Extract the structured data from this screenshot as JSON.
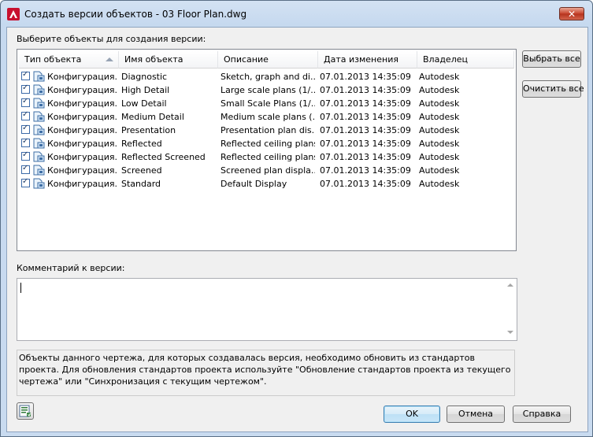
{
  "window": {
    "title": "Создать версии объектов - 03 Floor Plan.dwg",
    "close_label": "x",
    "close_icon": "close-icon"
  },
  "list": {
    "label": "Выберите объекты для создания версии:",
    "columns": [
      "Тип объекта",
      "Имя объекта",
      "Описание",
      "Дата изменения",
      "Владелец"
    ],
    "sort_column": "Тип объекта",
    "rows": [
      {
        "checked": true,
        "type": "Конфигурация...",
        "name": "Diagnostic",
        "description": "Sketch, graph and di...",
        "date": "07.01.2013 14:35:09",
        "owner": "Autodesk"
      },
      {
        "checked": true,
        "type": "Конфигурация...",
        "name": "High Detail",
        "description": "Large scale plans (1/...",
        "date": "07.01.2013 14:35:09",
        "owner": "Autodesk"
      },
      {
        "checked": true,
        "type": "Конфигурация...",
        "name": "Low Detail",
        "description": "Small Scale Plans (1/...",
        "date": "07.01.2013 14:35:09",
        "owner": "Autodesk"
      },
      {
        "checked": true,
        "type": "Конфигурация...",
        "name": "Medium Detail",
        "description": "Medium scale plans (...",
        "date": "07.01.2013 14:35:09",
        "owner": "Autodesk"
      },
      {
        "checked": true,
        "type": "Конфигурация...",
        "name": "Presentation",
        "description": "Presentation plan dis...",
        "date": "07.01.2013 14:35:09",
        "owner": "Autodesk"
      },
      {
        "checked": true,
        "type": "Конфигурация...",
        "name": "Reflected",
        "description": "Reflected ceiling plans",
        "date": "07.01.2013 14:35:09",
        "owner": "Autodesk"
      },
      {
        "checked": true,
        "type": "Конфигурация...",
        "name": "Reflected Screened",
        "description": "Reflected ceiling plans",
        "date": "07.01.2013 14:35:09",
        "owner": "Autodesk"
      },
      {
        "checked": true,
        "type": "Конфигурация...",
        "name": "Screened",
        "description": "Screened plan displa...",
        "date": "07.01.2013 14:35:09",
        "owner": "Autodesk"
      },
      {
        "checked": true,
        "type": "Конфигурация...",
        "name": "Standard",
        "description": "Default Display",
        "date": "07.01.2013 14:35:09",
        "owner": "Autodesk"
      }
    ]
  },
  "buttons": {
    "select_all": "Выбрать все",
    "clear_all": "Очистить все",
    "ok": "OK",
    "cancel": "Отмена",
    "help": "Справка"
  },
  "comment": {
    "label": "Комментарий к версии:",
    "value": ""
  },
  "info": {
    "text": "Объекты данного чертежа, для которых создавалась версия, необходимо обновить из стандартов проекта. Для обновления стандартов проекта используйте \"Обновление стандартов проекта из текущего чертежа\" или \"Синхронизация с текущим чертежом\"."
  },
  "colors": {
    "accent": "#3c7fb1",
    "close_button": "#c7432c",
    "app_icon": "#c8102e"
  }
}
